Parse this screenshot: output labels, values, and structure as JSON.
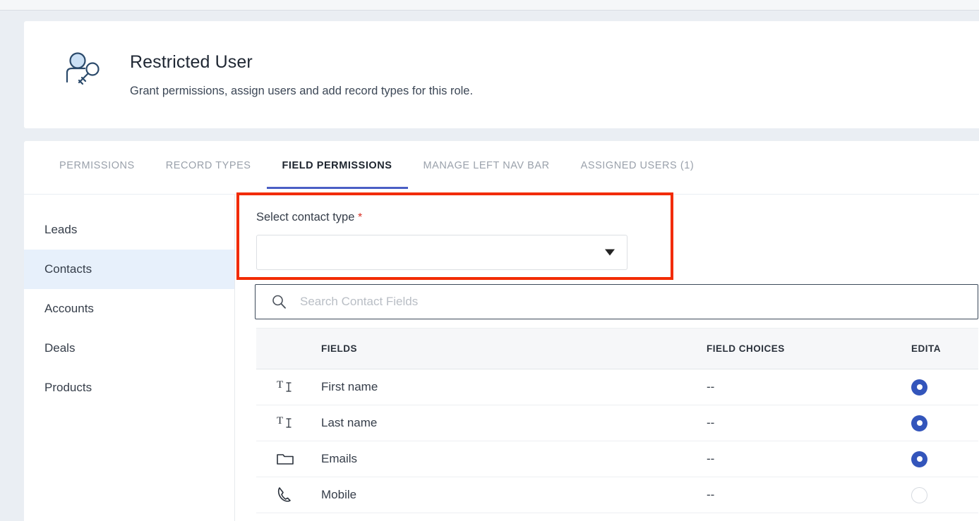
{
  "header": {
    "title": "Restricted User",
    "subtitle": "Grant permissions, assign users and add record types for this role.",
    "icon": "user-key-icon"
  },
  "tabs": [
    {
      "label": "PERMISSIONS",
      "active": false
    },
    {
      "label": "RECORD TYPES",
      "active": false
    },
    {
      "label": "FIELD PERMISSIONS",
      "active": true
    },
    {
      "label": "MANAGE LEFT NAV BAR",
      "active": false
    },
    {
      "label": "ASSIGNED USERS (1)",
      "active": false
    }
  ],
  "sidebar": {
    "items": [
      {
        "label": "Leads",
        "active": false
      },
      {
        "label": "Contacts",
        "active": true
      },
      {
        "label": "Accounts",
        "active": false
      },
      {
        "label": "Deals",
        "active": false
      },
      {
        "label": "Products",
        "active": false
      }
    ]
  },
  "contact_type_field": {
    "label": "Select contact type",
    "required_marker": "*",
    "value": "",
    "caret_icon": "chevron-down-icon"
  },
  "search": {
    "placeholder": "Search Contact Fields",
    "value": "",
    "icon": "search-icon"
  },
  "table": {
    "columns": [
      "",
      "FIELDS",
      "FIELD CHOICES",
      "EDITA"
    ],
    "rows": [
      {
        "icon": "text-field-icon",
        "field": "First name",
        "choices": "--",
        "editable": true
      },
      {
        "icon": "text-field-icon",
        "field": "Last name",
        "choices": "--",
        "editable": true
      },
      {
        "icon": "folder-icon",
        "field": "Emails",
        "choices": "--",
        "editable": true
      },
      {
        "icon": "phone-icon",
        "field": "Mobile",
        "choices": "--",
        "editable": false
      }
    ]
  },
  "colors": {
    "accent_blue": "#3355bb",
    "tab_underline": "#4a5ec4",
    "sidebar_active_bg": "#e7f0fb",
    "annotation_red": "#f22b00",
    "required_red": "#d93025"
  }
}
